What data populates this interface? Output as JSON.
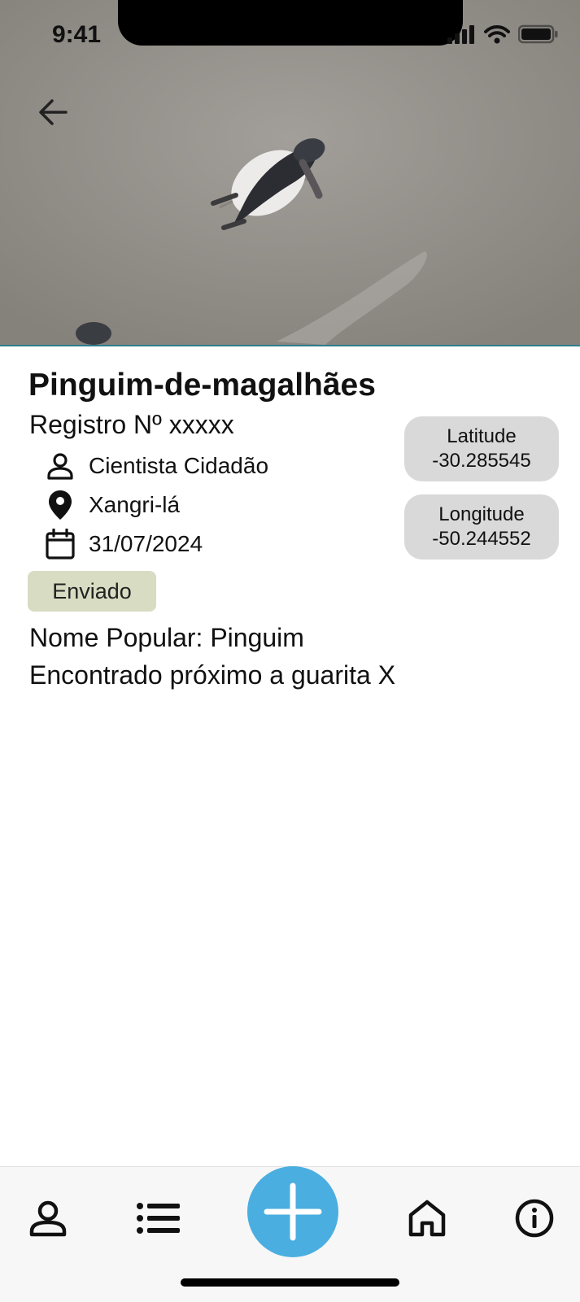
{
  "status_bar": {
    "time": "9:41"
  },
  "record": {
    "title": "Pinguim-de-magalhães",
    "registro": "Registro Nº xxxxx",
    "author": "Cientista Cidadão",
    "location": "Xangri-lá",
    "date": "31/07/2024",
    "status": "Enviado",
    "latitude_label": "Latitude",
    "latitude_value": "-30.285545",
    "longitude_label": "Longitude",
    "longitude_value": "-50.244552",
    "popular_name": "Nome Popular: Pinguim",
    "note": "Encontrado próximo a guarita X"
  },
  "icons": {
    "back": "arrow-left-icon",
    "author": "person-icon",
    "location": "map-pin-icon",
    "date": "calendar-icon",
    "tabs": [
      "person-icon",
      "list-icon",
      "plus-icon",
      "home-icon",
      "info-icon"
    ]
  },
  "colors": {
    "accent": "#4aaee0",
    "badge": "#d8dcc2",
    "coord_pill": "#d9d9d9",
    "hero_border": "#2b7f8e"
  }
}
